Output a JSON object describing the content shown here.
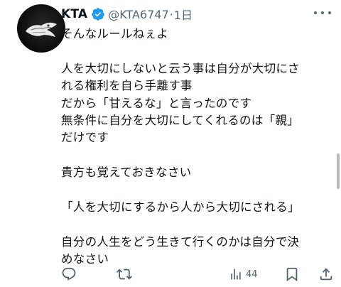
{
  "tweet": {
    "author_name": "KTA",
    "handle": "@KTA6747",
    "separator": "·",
    "time": "1日",
    "lines": [
      "そんなルールねぇよ",
      "",
      "人を大切にしないと云う事は自分が大切にさ",
      "れる権利を自ら手離す事",
      "だから「甘えるな」と言ったのです",
      "無条件に自分を大切にしてくれるのは「親」",
      "だけです",
      "",
      "貴方も覚えておきなさい",
      "",
      "「人を大切にするから人から大切にされる」",
      "",
      "自分の人生をどう生きて行くのかは自分で決",
      "めなさい"
    ],
    "views_count": "44"
  },
  "icons": {
    "verified": "verified-badge-icon",
    "more": "more-options-icon",
    "reply": "reply-icon",
    "retweet": "retweet-icon",
    "views": "views-icon",
    "bookmark": "bookmark-icon",
    "share": "share-icon"
  },
  "colors": {
    "verified": "#1d9bf0",
    "secondary_text": "#536471",
    "primary_text": "#0f1419"
  }
}
